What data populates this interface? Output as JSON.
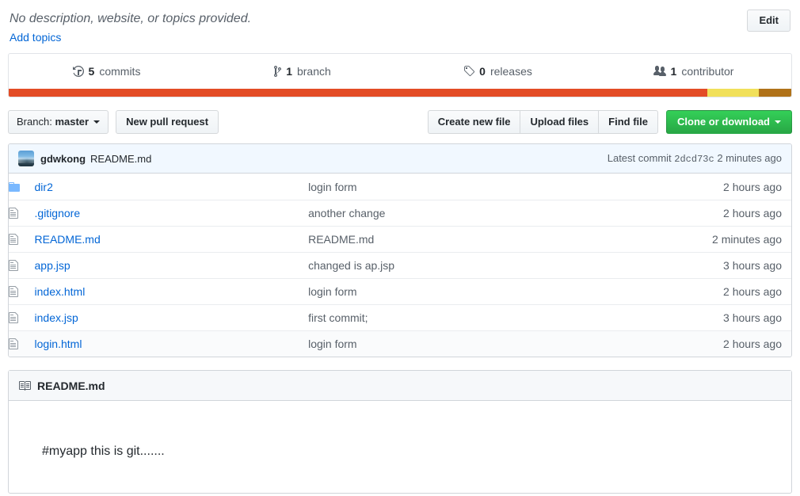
{
  "header": {
    "description": "No description, website, or topics provided.",
    "add_topics_label": "Add topics",
    "edit_label": "Edit"
  },
  "stats": [
    {
      "icon": "history-icon",
      "count": "5",
      "label": "commits",
      "name": "stat-commits"
    },
    {
      "icon": "git-branch-icon",
      "count": "1",
      "label": "branch",
      "name": "stat-branches"
    },
    {
      "icon": "tag-icon",
      "count": "0",
      "label": "releases",
      "name": "stat-releases"
    },
    {
      "icon": "organization-icon",
      "count": "1",
      "label": "contributor",
      "name": "stat-contributors"
    }
  ],
  "languages": [
    {
      "name": "segment-1",
      "color": "#e34c26",
      "percent": 89.3
    },
    {
      "name": "segment-2",
      "color": "#f1e05a",
      "percent": 6.5
    },
    {
      "name": "segment-3",
      "color": "#b07219",
      "percent": 4.2
    }
  ],
  "toolbar": {
    "branch_prefix": "Branch:",
    "branch_name": "master",
    "new_pull_request": "New pull request",
    "create_new_file": "Create new file",
    "upload_files": "Upload files",
    "find_file": "Find file",
    "clone_or_download": "Clone or download"
  },
  "latest_commit": {
    "author": "gdwkong",
    "message": "README.md",
    "label": "Latest commit",
    "sha": "2dcd73c",
    "age": "2 minutes ago"
  },
  "files": [
    {
      "icon": "directory-icon",
      "type": "dir",
      "name": "dir2",
      "message": "login form",
      "age": "2 hours ago"
    },
    {
      "icon": "file-icon",
      "type": "file",
      "name": ".gitignore",
      "message": "another change",
      "age": "2 hours ago"
    },
    {
      "icon": "file-icon",
      "type": "file",
      "name": "README.md",
      "message": "README.md",
      "age": "2 minutes ago"
    },
    {
      "icon": "file-icon",
      "type": "file",
      "name": "app.jsp",
      "message": "changed is ap.jsp",
      "age": "3 hours ago"
    },
    {
      "icon": "file-icon",
      "type": "file",
      "name": "index.html",
      "message": "login form",
      "age": "2 hours ago"
    },
    {
      "icon": "file-icon",
      "type": "file",
      "name": "index.jsp",
      "message": "first commit;",
      "age": "3 hours ago"
    },
    {
      "icon": "file-icon",
      "type": "file",
      "name": "login.html",
      "message": "login form",
      "age": "2 hours ago"
    }
  ],
  "readme": {
    "title": "README.md",
    "icon": "book-icon",
    "content": "#myapp this is git......."
  }
}
